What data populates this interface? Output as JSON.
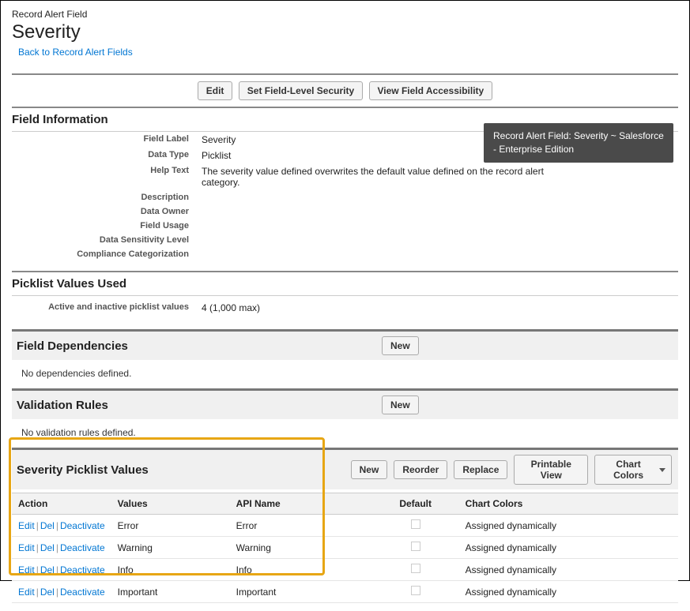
{
  "header": {
    "crumb": "Record Alert Field",
    "title": "Severity",
    "back_link": "Back to Record Alert Fields"
  },
  "top_buttons": {
    "edit": "Edit",
    "security": "Set Field-Level Security",
    "accessibility": "View Field Accessibility"
  },
  "field_info": {
    "section_title": "Field Information",
    "rows": {
      "field_label": {
        "label": "Field Label",
        "value": "Severity"
      },
      "data_type": {
        "label": "Data Type",
        "value": "Picklist"
      },
      "help_text": {
        "label": "Help Text",
        "value": "The severity value defined overwrites the default value defined on the record alert category."
      },
      "description": {
        "label": "Description",
        "value": ""
      },
      "data_owner": {
        "label": "Data Owner",
        "value": ""
      },
      "field_usage": {
        "label": "Field Usage",
        "value": ""
      },
      "data_sensitivity": {
        "label": "Data Sensitivity Level",
        "value": ""
      },
      "compliance": {
        "label": "Compliance Categorization",
        "value": ""
      }
    }
  },
  "picklist_used": {
    "section_title": "Picklist Values Used",
    "row_label": "Active and inactive picklist values",
    "row_value": "4 (1,000 max)"
  },
  "field_deps": {
    "section_title": "Field Dependencies",
    "new_btn": "New",
    "empty": "No dependencies defined."
  },
  "validation": {
    "section_title": "Validation Rules",
    "new_btn": "New",
    "empty": "No validation rules defined."
  },
  "picklist_values": {
    "section_title": "Severity Picklist Values",
    "buttons": {
      "new": "New",
      "reorder": "Reorder",
      "replace": "Replace",
      "printable": "Printable View",
      "chart_colors": "Chart Colors"
    },
    "columns": {
      "action": "Action",
      "values": "Values",
      "api_name": "API Name",
      "default": "Default",
      "chart_colors": "Chart Colors"
    },
    "action_labels": {
      "edit": "Edit",
      "del": "Del",
      "deactivate": "Deactivate"
    },
    "rows": [
      {
        "value": "Error",
        "api_name": "Error",
        "default": false,
        "chart_colors": "Assigned dynamically"
      },
      {
        "value": "Warning",
        "api_name": "Warning",
        "default": false,
        "chart_colors": "Assigned dynamically"
      },
      {
        "value": "Info",
        "api_name": "Info",
        "default": false,
        "chart_colors": "Assigned dynamically"
      },
      {
        "value": "Important",
        "api_name": "Important",
        "default": false,
        "chart_colors": "Assigned dynamically"
      }
    ]
  },
  "tooltip": "Record Alert Field: Severity ~ Salesforce - Enterprise Edition"
}
